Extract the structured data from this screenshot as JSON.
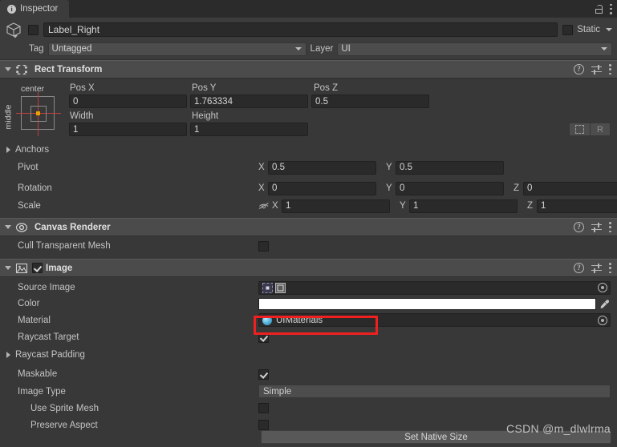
{
  "window": {
    "tab_label": "Inspector",
    "tab_icon": "info-icon",
    "lock_icon": "lock-open-icon",
    "menu_icon": "kebab-menu-icon"
  },
  "object_header": {
    "icon": "cube-icon",
    "enabled": false,
    "name": "Label_Right",
    "static_label": "Static",
    "tag_label": "Tag",
    "tag_value": "Untagged",
    "layer_label": "Layer",
    "layer_value": "UI"
  },
  "components": [
    {
      "title": "Rect Transform",
      "icon": "rect-transform-icon",
      "expanded": true,
      "tools": [
        "help-icon",
        "preset-icon",
        "kebab-menu-icon"
      ]
    },
    {
      "title": "Canvas Renderer",
      "icon": "eye-icon",
      "expanded": true,
      "tools": [
        "help-icon",
        "preset-icon",
        "kebab-menu-icon"
      ]
    },
    {
      "title": "Image",
      "icon": "image-icon",
      "expanded": true,
      "enabled": true,
      "tools": [
        "help-icon",
        "preset-icon",
        "kebab-menu-icon"
      ]
    }
  ],
  "rect_transform": {
    "anchor_preset": {
      "horizontal": "center",
      "vertical": "middle"
    },
    "col_labels_row1": [
      "Pos X",
      "Pos Y",
      "Pos Z"
    ],
    "col_values_row1": [
      "0",
      "1.763334",
      "0.5"
    ],
    "col_labels_row2": [
      "Width",
      "Height"
    ],
    "col_values_row2": [
      "1",
      "1"
    ],
    "blueprint_button": "blueprint-mode-icon",
    "raw_button": "R",
    "anchors_label": "Anchors",
    "pivot_label": "Pivot",
    "pivot": {
      "x_axis": "X",
      "x": "0.5",
      "y_axis": "Y",
      "y": "0.5"
    },
    "rotation_label": "Rotation",
    "rotation": {
      "x_axis": "X",
      "x": "0",
      "y_axis": "Y",
      "y": "0",
      "z_axis": "Z",
      "z": "0"
    },
    "scale_label": "Scale",
    "scale_lock_icon": "link-off-icon",
    "scale": {
      "x_axis": "X",
      "x": "1",
      "y_axis": "Y",
      "y": "1",
      "z_axis": "Z",
      "z": "1"
    }
  },
  "canvas_renderer": {
    "cull_label": "Cull Transparent Mesh",
    "cull_checked": false
  },
  "image": {
    "source_image_label": "Source Image",
    "source_image_value": "",
    "source_image_icon": "sprite-icon",
    "color_label": "Color",
    "color_value": "#FFFFFF",
    "eyedropper_icon": "eyedropper-icon",
    "material_label": "Material",
    "material_value": "UIMaterials",
    "material_icon": "material-sphere-icon",
    "raycast_target_label": "Raycast Target",
    "raycast_target_checked": true,
    "raycast_padding_label": "Raycast Padding",
    "maskable_label": "Maskable",
    "maskable_checked": true,
    "image_type_label": "Image Type",
    "image_type_value": "Simple",
    "use_sprite_mesh_label": "Use Sprite Mesh",
    "use_sprite_mesh_checked": false,
    "preserve_aspect_label": "Preserve Aspect",
    "preserve_aspect_checked": false,
    "set_native_size_label": "Set Native Size"
  },
  "annotation": {
    "highlight_color": "#F02020",
    "target": "material-field"
  },
  "watermark": "CSDN @m_dlwlrma"
}
